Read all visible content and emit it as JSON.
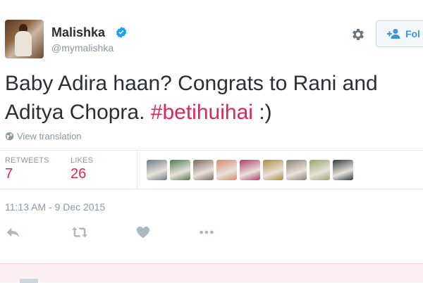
{
  "profile": {
    "name": "Malishka",
    "handle": "@mymalishka",
    "verified_icon": "verified-badge-icon",
    "accent_color": "#1da1f2"
  },
  "follow_button": {
    "label": "Fol",
    "icon": "add-user-icon"
  },
  "settings_icon": "gear-icon",
  "tweet": {
    "text_before": "Baby Adira haan? Congrats to Rani and Aditya Chopra.",
    "hashtag": "#betihuihai",
    "text_after": ":)",
    "hashtag_color": "#e0245e"
  },
  "translate": {
    "label": "View translation",
    "icon": "globe-icon"
  },
  "stats": {
    "retweets_label": "RETWEETS",
    "retweets_value": "7",
    "likes_label": "LIKES",
    "likes_value": "26"
  },
  "likers": [
    {
      "name": "liker-1",
      "color": "#6b7b8a"
    },
    {
      "name": "liker-2",
      "color": "#4d7a4f"
    },
    {
      "name": "liker-3",
      "color": "#7a6a5a"
    },
    {
      "name": "liker-4",
      "color": "#d98a6a"
    },
    {
      "name": "liker-5",
      "color": "#b03a6a"
    },
    {
      "name": "liker-6",
      "color": "#b08a3a"
    },
    {
      "name": "liker-7",
      "color": "#8a7f77"
    },
    {
      "name": "liker-8",
      "color": "#9aa36a"
    },
    {
      "name": "liker-9",
      "color": "#2f3a3a"
    }
  ],
  "timestamp": "11:13 AM - 9 Dec 2015",
  "actions": [
    "reply-icon",
    "retweet-icon",
    "like-icon",
    "more-icon"
  ]
}
